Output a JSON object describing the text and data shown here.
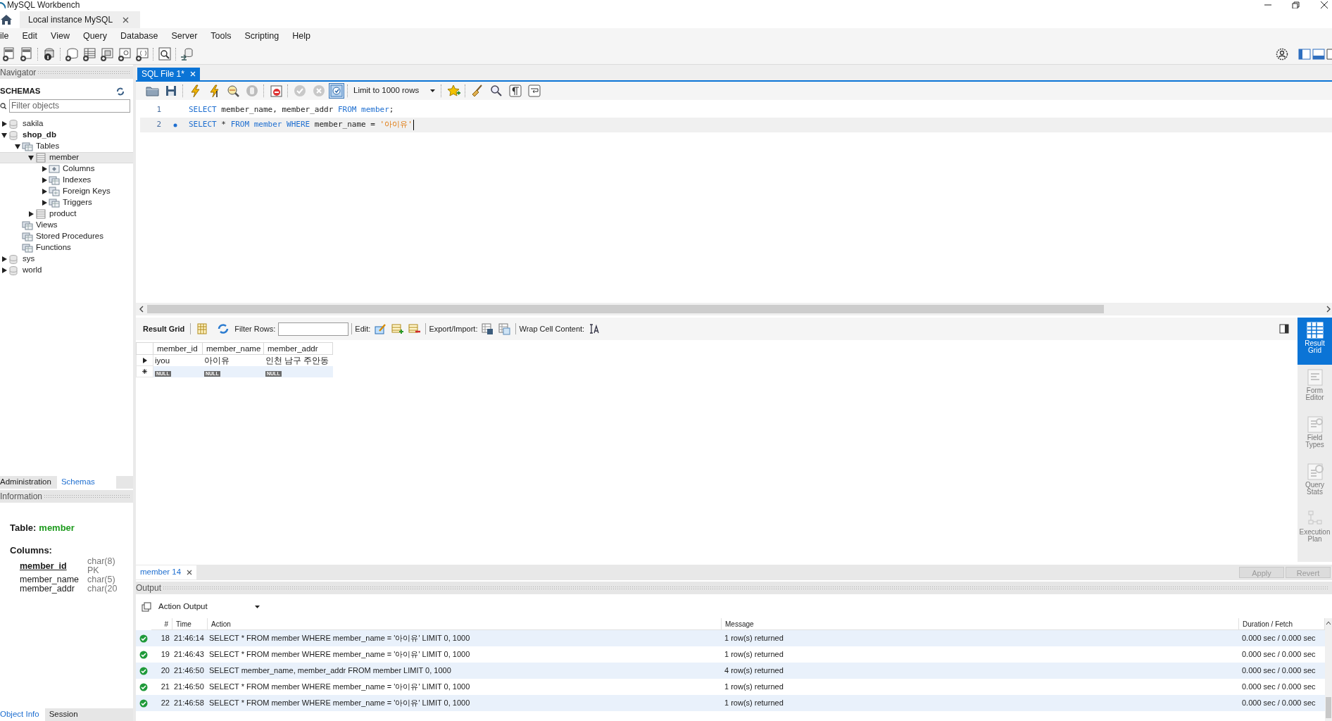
{
  "window": {
    "title": "MySQL Workbench"
  },
  "connection_tabs": [
    {
      "label": "Local instance MySQL",
      "selected": true
    }
  ],
  "menu": [
    "ile",
    "Edit",
    "View",
    "Query",
    "Database",
    "Server",
    "Tools",
    "Scripting",
    "Help"
  ],
  "navigator": {
    "title": "Navigator",
    "schemas_title": "SCHEMAS",
    "filter_placeholder": "Filter objects",
    "tree": [
      {
        "label": "sakila",
        "kind": "schema",
        "expanded": false,
        "default": false,
        "selected": false
      },
      {
        "label": "shop_db",
        "kind": "schema",
        "expanded": true,
        "default": true,
        "selected": false,
        "children": [
          {
            "label": "Tables",
            "kind": "folder",
            "expanded": true,
            "selected": false,
            "children": [
              {
                "label": "member",
                "kind": "table",
                "expanded": true,
                "selected": true,
                "children": [
                  {
                    "label": "Columns",
                    "kind": "columns",
                    "expanded": false,
                    "selected": false
                  },
                  {
                    "label": "Indexes",
                    "kind": "folder",
                    "expanded": false,
                    "selected": false
                  },
                  {
                    "label": "Foreign Keys",
                    "kind": "keys",
                    "expanded": false,
                    "selected": false
                  },
                  {
                    "label": "Triggers",
                    "kind": "folder",
                    "expanded": false,
                    "selected": false
                  }
                ]
              },
              {
                "label": "product",
                "kind": "table",
                "expanded": false,
                "selected": false
              }
            ]
          },
          {
            "label": "Views",
            "kind": "folder",
            "selected": false
          },
          {
            "label": "Stored Procedures",
            "kind": "folder",
            "selected": false
          },
          {
            "label": "Functions",
            "kind": "folder",
            "selected": false
          }
        ]
      },
      {
        "label": "sys",
        "kind": "schema",
        "expanded": false,
        "default": false,
        "selected": false
      },
      {
        "label": "world",
        "kind": "schema",
        "expanded": false,
        "default": false,
        "selected": false
      }
    ],
    "tabs": [
      {
        "label": "Administration",
        "selected": false
      },
      {
        "label": "Schemas",
        "selected": true
      }
    ]
  },
  "information": {
    "title": "Information",
    "table_label": "Table:",
    "table_name": "member",
    "columns_label": "Columns:",
    "columns": [
      {
        "name": "member_id",
        "type": "char(8)",
        "key": "PK",
        "primary": true
      },
      {
        "name": "member_name",
        "type": "char(5)",
        "primary": false
      },
      {
        "name": "member_addr",
        "type": "char(20",
        "primary": false
      }
    ],
    "tabs": [
      {
        "label": "Object Info",
        "selected": true
      },
      {
        "label": "Session",
        "selected": false
      }
    ]
  },
  "editor": {
    "tabs": [
      {
        "label": "SQL File 1*",
        "selected": true
      }
    ],
    "limit": "Limit to 1000 rows",
    "autocommit": true,
    "lines": [
      {
        "number": "1",
        "marker": false,
        "current": false,
        "tokens": [
          {
            "text": "SELECT",
            "kind": "keyword"
          },
          {
            "text": " member_name, member_addr ",
            "kind": "plain"
          },
          {
            "text": "FROM member",
            "kind": "keyword"
          },
          {
            "text": ";",
            "kind": "plain"
          }
        ]
      },
      {
        "number": "2",
        "marker": true,
        "current": true,
        "tokens": [
          {
            "text": "SELECT",
            "kind": "keyword"
          },
          {
            "text": " * ",
            "kind": "plain"
          },
          {
            "text": "FROM member WHERE",
            "kind": "keyword"
          },
          {
            "text": " member_name = ",
            "kind": "plain"
          },
          {
            "text": "'아이유'",
            "kind": "string"
          }
        ]
      }
    ]
  },
  "result": {
    "toolbar": {
      "view_label": "Result Grid",
      "filter_label": "Filter Rows:",
      "edit_label": "Edit:",
      "export_label": "Export/Import:",
      "wrap_label": "Wrap Cell Content:"
    },
    "columns": [
      "member_id",
      "member_name",
      "member_addr"
    ],
    "rows": [
      {
        "kind": "data",
        "cells": [
          "iyou",
          "아이유",
          "인천 남구 주안동"
        ]
      },
      {
        "kind": "new",
        "cells": [
          "NULL",
          "NULL",
          "NULL"
        ]
      }
    ],
    "side_panel": [
      {
        "label": "Result Grid",
        "selected": true
      },
      {
        "label": "Form Editor",
        "selected": false
      },
      {
        "label": "Field Types",
        "selected": false
      },
      {
        "label": "Query Stats",
        "selected": false
      },
      {
        "label": "Execution Plan",
        "selected": false
      }
    ],
    "tabs": [
      {
        "label": "member 14",
        "selected": true
      }
    ],
    "buttons": [
      {
        "label": "Apply",
        "disabled": true
      },
      {
        "label": "Revert",
        "disabled": true
      }
    ]
  },
  "output": {
    "title": "Output",
    "selector": "Action Output",
    "columns": [
      "#",
      "Time",
      "Action",
      "Message",
      "Duration / Fetch"
    ],
    "rows": [
      {
        "success": true,
        "number": "18",
        "time": "21:46:14",
        "action": "SELECT * FROM member WHERE member_name = '아이유' LIMIT 0, 1000",
        "message": "1 row(s) returned",
        "duration": "0.000 sec / 0.000 sec"
      },
      {
        "success": true,
        "number": "19",
        "time": "21:46:43",
        "action": "SELECT * FROM member WHERE member_name = '아이유' LIMIT 0, 1000",
        "message": "1 row(s) returned",
        "duration": "0.000 sec / 0.000 sec"
      },
      {
        "success": true,
        "number": "20",
        "time": "21:46:50",
        "action": "SELECT member_name, member_addr FROM member LIMIT 0, 1000",
        "message": "4 row(s) returned",
        "duration": "0.000 sec / 0.000 sec"
      },
      {
        "success": true,
        "number": "21",
        "time": "21:46:50",
        "action": "SELECT * FROM member WHERE member_name = '아이유' LIMIT 0, 1000",
        "message": "1 row(s) returned",
        "duration": "0.000 sec / 0.000 sec"
      },
      {
        "success": true,
        "number": "22",
        "time": "21:46:58",
        "action": "SELECT * FROM member WHERE member_name = '아이유' LIMIT 0, 1000",
        "message": "1 row(s) returned",
        "duration": "0.000 sec / 0.000 sec"
      }
    ]
  }
}
